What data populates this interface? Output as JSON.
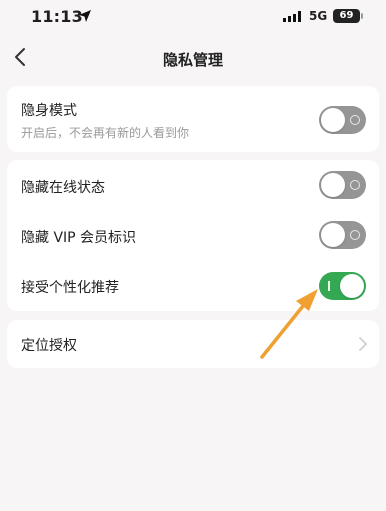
{
  "status_bar": {
    "time": "11:13",
    "network": "5G",
    "battery": "69"
  },
  "nav": {
    "title": "隐私管理"
  },
  "settings": {
    "stealth": {
      "label": "隐身模式",
      "description": "开启后，不会再有新的人看到你",
      "enabled": false
    },
    "hide_online": {
      "label": "隐藏在线状态",
      "enabled": false
    },
    "hide_vip": {
      "label": "隐藏 VIP 会员标识",
      "enabled": false
    },
    "personalized": {
      "label": "接受个性化推荐",
      "enabled": true
    },
    "location": {
      "label": "定位授权"
    }
  },
  "colors": {
    "toggle_on": "#34a853",
    "toggle_off": "#959595",
    "annotation_arrow": "#f0a030",
    "background": "#f7f5f6"
  }
}
